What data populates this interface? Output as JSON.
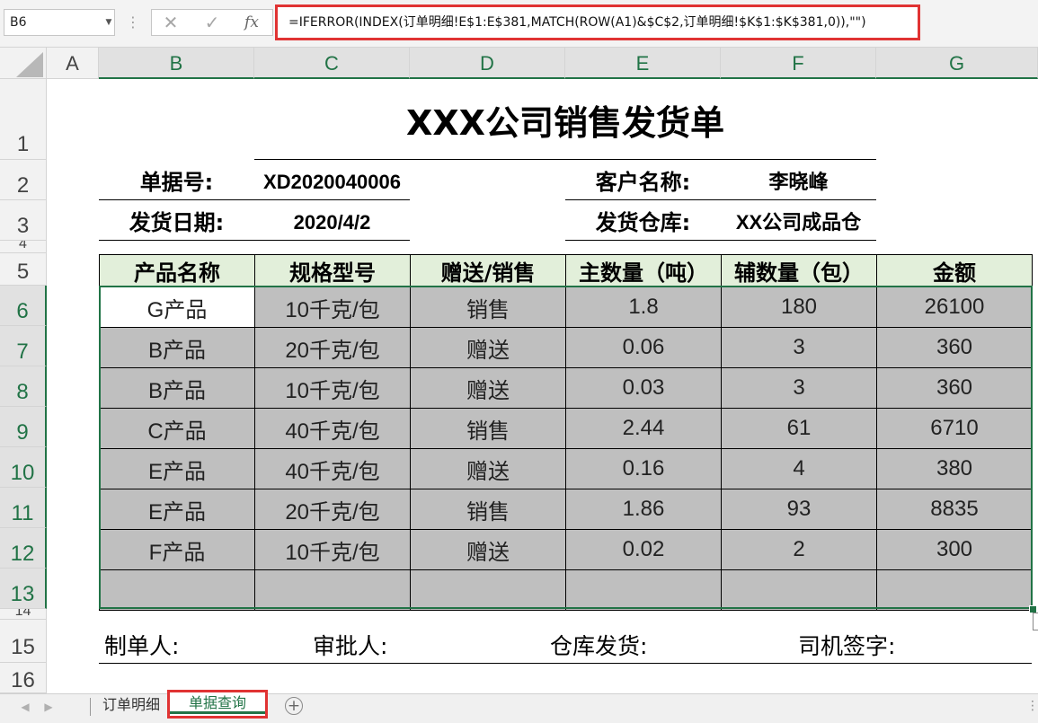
{
  "formula_bar": {
    "name_box": "B6",
    "formula": "=IFERROR(INDEX(订单明细!E$1:E$381,MATCH(ROW(A1)&$C$2,订单明细!$K$1:$K$381,0)),\"\")",
    "fx_label": "fx"
  },
  "columns": [
    "A",
    "B",
    "C",
    "D",
    "E",
    "F",
    "G"
  ],
  "rows": [
    "1",
    "2",
    "3",
    "4",
    "5",
    "6",
    "7",
    "8",
    "9",
    "10",
    "11",
    "12",
    "13",
    "14",
    "15",
    "16"
  ],
  "sheet": {
    "title": "XXX公司销售发货单",
    "doc_no_label": "单据号:",
    "doc_no": "XD2020040006",
    "customer_label": "客户名称:",
    "customer": "李晓峰",
    "ship_date_label": "发货日期:",
    "ship_date": "2020/4/2",
    "warehouse_label": "发货仓库:",
    "warehouse": "XX公司成品仓",
    "headers": [
      "产品名称",
      "规格型号",
      "赠送/销售",
      "主数量（吨）",
      "辅数量（包）",
      "金额"
    ],
    "rows": [
      [
        "G产品",
        "10千克/包",
        "销售",
        "1.8",
        "180",
        "26100"
      ],
      [
        "B产品",
        "20千克/包",
        "赠送",
        "0.06",
        "3",
        "360"
      ],
      [
        "B产品",
        "10千克/包",
        "赠送",
        "0.03",
        "3",
        "360"
      ],
      [
        "C产品",
        "40千克/包",
        "销售",
        "2.44",
        "61",
        "6710"
      ],
      [
        "E产品",
        "40千克/包",
        "赠送",
        "0.16",
        "4",
        "380"
      ],
      [
        "E产品",
        "20千克/包",
        "销售",
        "1.86",
        "93",
        "8835"
      ],
      [
        "F产品",
        "10千克/包",
        "赠送",
        "0.02",
        "2",
        "300"
      ],
      [
        "",
        "",
        "",
        "",
        "",
        ""
      ]
    ],
    "signatures": [
      "制单人:",
      "审批人:",
      "仓库发货:",
      "司机签字:"
    ]
  },
  "tabs": [
    {
      "label": "订单明细",
      "active": false
    },
    {
      "label": "单据查询",
      "active": true
    }
  ],
  "colors": {
    "accent": "#217346",
    "highlight_border": "#e03333",
    "table_header_bg": "#e2efda",
    "data_fill": "#bfbfbf"
  }
}
